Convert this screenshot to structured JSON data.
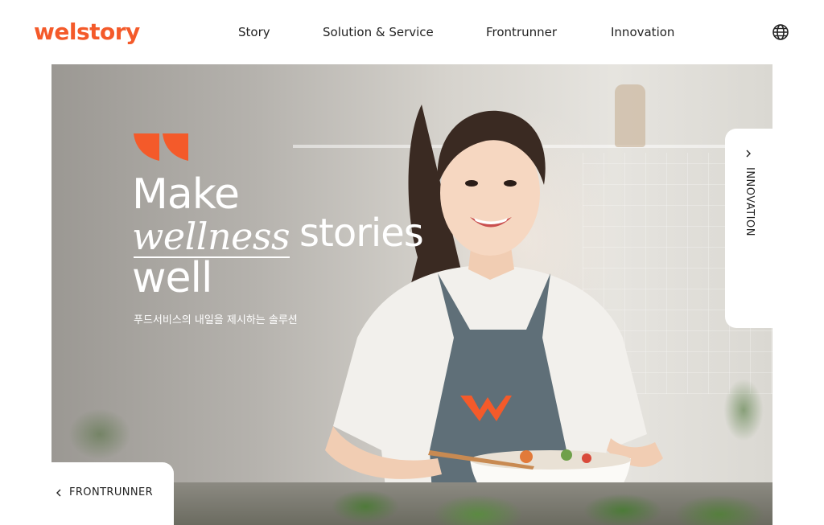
{
  "header": {
    "logo_text": "welstory",
    "nav": [
      {
        "label": "Story"
      },
      {
        "label": "Solution & Service"
      },
      {
        "label": "Frontrunner"
      },
      {
        "label": "Innovation"
      }
    ],
    "language_icon": "globe-icon"
  },
  "hero": {
    "headline": {
      "line1": "Make",
      "emphasis": "wellness",
      "line2_rest": "stories",
      "line3": "well"
    },
    "subtitle": "푸드서비스의 내일을 제시하는 솔루션",
    "quote_icon": "quote-mark-icon",
    "apron_logo_icon": "welstory-w-logo-icon"
  },
  "side_tabs": {
    "next": {
      "label": "INNOVATION",
      "icon": "chevron-right-icon"
    },
    "prev": {
      "label": "FRONTRUNNER",
      "icon": "chevron-left-icon"
    }
  },
  "colors": {
    "brand": "#f45a2a",
    "text_dark": "#222222",
    "hero_text": "#ffffff"
  }
}
